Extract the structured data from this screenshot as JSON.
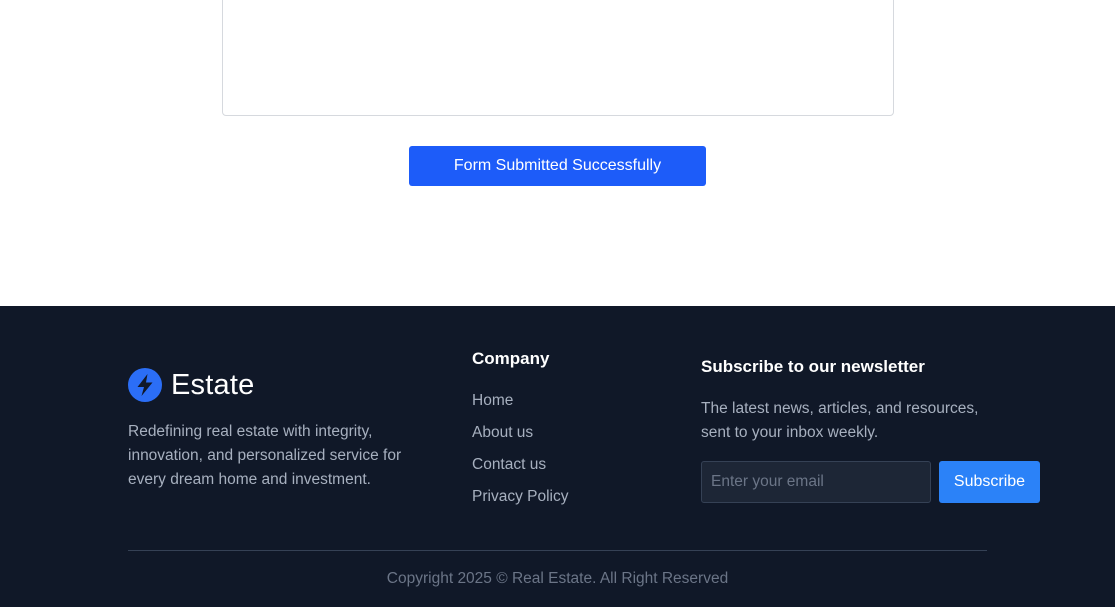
{
  "form": {
    "submit_label": "Form Submitted Successfully"
  },
  "footer": {
    "brand": {
      "name": "Estate",
      "icon": "lightning-bolt-icon",
      "description": "Redefining real estate with integrity, innovation, and personalized service for every dream home and investment."
    },
    "company": {
      "heading": "Company",
      "links": [
        "Home",
        "About us",
        "Contact us",
        "Privacy Policy"
      ]
    },
    "newsletter": {
      "heading": "Subscribe to our newsletter",
      "description": "The latest news, articles, and resources, sent to your inbox weekly.",
      "email_placeholder": "Enter your email",
      "email_value": "",
      "subscribe_label": "Subscribe"
    },
    "copyright": "Copyright 2025 © Real Estate. All Right Reserved"
  },
  "colors": {
    "accent": "#1d5cf9",
    "subscribe": "#2b82f8",
    "footer_bg": "#101828"
  }
}
